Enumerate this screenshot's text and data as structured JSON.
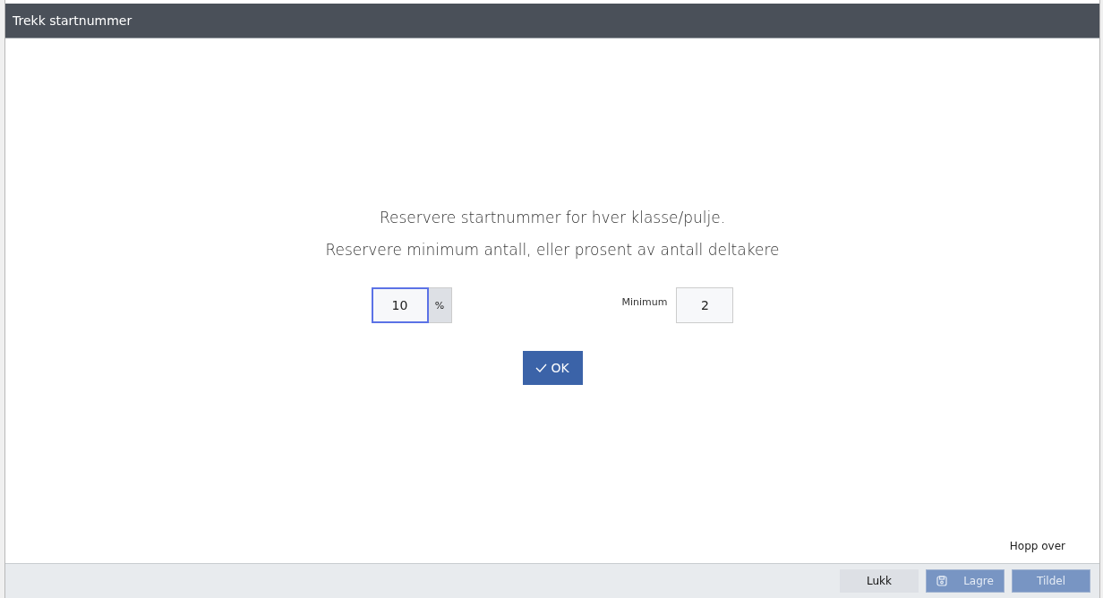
{
  "window": {
    "title": "Trekk startnummer"
  },
  "intro": [
    "Reservere startnummer for hver klasse/pulje.",
    "Reservere minimum antall, eller prosent av antall deltakere"
  ],
  "percent_field": {
    "value": "10",
    "unit": "%",
    "focused": true
  },
  "minimum_field": {
    "label": "Minimum",
    "value": "2",
    "focused": false
  },
  "ok_button": {
    "label": "OK"
  },
  "skip_link": "Hopp over",
  "footer_buttons": [
    {
      "kind": "plain",
      "label": "Lukk",
      "disabled": false
    },
    {
      "kind": "save",
      "label": "Lagre",
      "disabled": true
    },
    {
      "kind": "plain",
      "label": "Tildel",
      "disabled": true
    }
  ]
}
